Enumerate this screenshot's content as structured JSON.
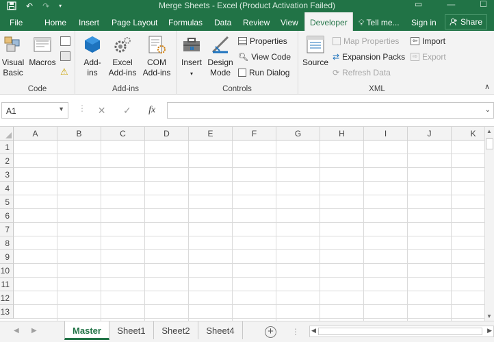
{
  "window": {
    "title": "Merge Sheets - Excel (Product Activation Failed)"
  },
  "qat": {
    "save_icon": "save-icon",
    "undo_icon": "undo-icon",
    "redo_icon": "redo-icon",
    "customize_icon": "customize-qat-icon"
  },
  "tabs": {
    "file": "File",
    "home": "Home",
    "insert": "Insert",
    "page_layout": "Page Layout",
    "formulas": "Formulas",
    "data": "Data",
    "review": "Review",
    "view": "View",
    "developer": "Developer",
    "tell_me": "Tell me...",
    "sign_in": "Sign in",
    "share": "Share"
  },
  "ribbon": {
    "code": {
      "label": "Code",
      "visual_basic": [
        "Visual",
        "Basic"
      ],
      "macros": "Macros"
    },
    "addins": {
      "label": "Add-ins",
      "addins": [
        "Add-",
        "ins"
      ],
      "excel_addins": [
        "Excel",
        "Add-ins"
      ],
      "com_addins": [
        "COM",
        "Add-ins"
      ]
    },
    "controls": {
      "label": "Controls",
      "insert": "Insert",
      "design_mode": [
        "Design",
        "Mode"
      ],
      "properties": "Properties",
      "view_code": "View Code",
      "run_dialog": "Run Dialog"
    },
    "xml": {
      "label": "XML",
      "source": "Source",
      "map_properties": "Map Properties",
      "expansion_packs": "Expansion Packs",
      "refresh_data": "Refresh Data",
      "import": "Import",
      "export": "Export"
    }
  },
  "formula_bar": {
    "name_box": "A1",
    "fx": "fx",
    "cancel": "✕",
    "enter": "✓",
    "formula": ""
  },
  "grid": {
    "columns": [
      "A",
      "B",
      "C",
      "D",
      "E",
      "F",
      "G",
      "H",
      "I",
      "J",
      "K"
    ],
    "rows": [
      "1",
      "2",
      "3",
      "4",
      "5",
      "6",
      "7",
      "8",
      "9",
      "10",
      "11",
      "12",
      "13"
    ]
  },
  "sheets": {
    "tabs": [
      "Master",
      "Sheet1",
      "Sheet2",
      "Sheet4"
    ],
    "active": "Master"
  },
  "colors": {
    "accent": "#217346",
    "ribbon_bg": "#f3f3f3",
    "grid_line": "#dadada"
  }
}
